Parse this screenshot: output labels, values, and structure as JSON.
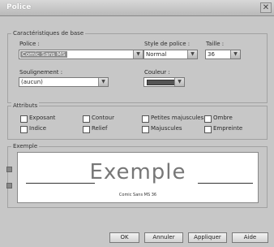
{
  "window": {
    "title": "Police"
  },
  "basic": {
    "legend": "Caractéristiques de base",
    "font_label": "Police :",
    "font_value": "Comic Sans MS",
    "style_label": "Style de police :",
    "style_value": "Normal",
    "size_label": "Taille :",
    "size_value": "36",
    "underline_label": "Soulignement :",
    "underline_value": "(aucun)",
    "color_label": "Couleur :",
    "color_value": "#555555"
  },
  "attributes": {
    "legend": "Attributs",
    "items": [
      {
        "label": "Exposant",
        "checked": false
      },
      {
        "label": "Contour",
        "checked": false
      },
      {
        "label": "Petites majuscules",
        "checked": false
      },
      {
        "label": "Ombre",
        "checked": false
      },
      {
        "label": "Indice",
        "checked": false
      },
      {
        "label": "Relief",
        "checked": false
      },
      {
        "label": "Majuscules",
        "checked": false
      },
      {
        "label": "Empreinte",
        "checked": false
      }
    ]
  },
  "preview": {
    "legend": "Exemple",
    "sample_text": "Exemple",
    "font_info": "Comic Sans MS 36"
  },
  "buttons": {
    "ok": "OK",
    "cancel": "Annuler",
    "apply": "Appliquer",
    "help": "Aide"
  }
}
